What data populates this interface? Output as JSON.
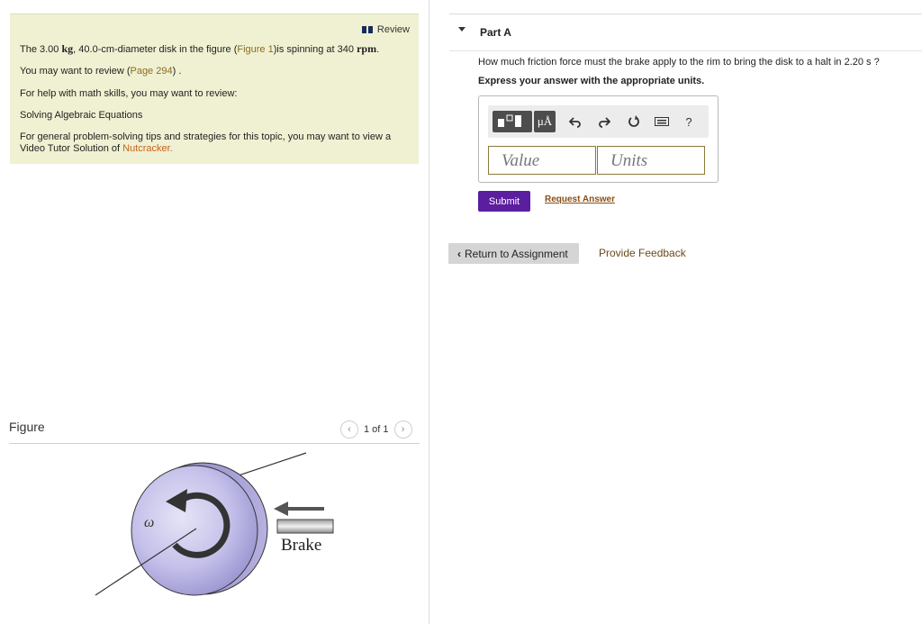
{
  "review": {
    "label": "Review"
  },
  "problem": {
    "intro_a": "The 3.00 ",
    "unit_kg": "kg",
    "intro_b": ", 40.0-cm-diameter disk in the figure (",
    "figure_link": "Figure 1",
    "intro_c": ")is spinning at 340 ",
    "unit_rpm": "rpm",
    "intro_d": ".",
    "review_prefix": "You may want to review (",
    "page_link": "Page 294",
    "review_suffix": ") .",
    "math_help": "For help with math skills, you may want to review:",
    "math_link": "Solving Algebraic Equations",
    "video_a": "For general problem-solving tips and strategies for this topic, you may want to view a",
    "video_b": "Video Tutor Solution of ",
    "video_link": "Nutcracker."
  },
  "figure": {
    "label": "Figure",
    "pager": "1 of 1",
    "omega": "ω",
    "brake": "Brake"
  },
  "part_a": {
    "title": "Part A",
    "question": "How much friction force must the brake apply to the rim to bring the disk to a halt in 2.20 s ?",
    "instruction": "Express your answer with the appropriate units.",
    "toolbar": {
      "mu_label": "μÅ",
      "help": "?"
    },
    "value_placeholder": "Value",
    "units_placeholder": "Units",
    "submit": "Submit",
    "request": "Request Answer"
  },
  "footer": {
    "return": "Return to Assignment",
    "feedback": "Provide Feedback"
  },
  "colors": {
    "accent": "#5b1e9f",
    "info_bg": "#f0f1d2",
    "link": "#8a6d1f"
  }
}
